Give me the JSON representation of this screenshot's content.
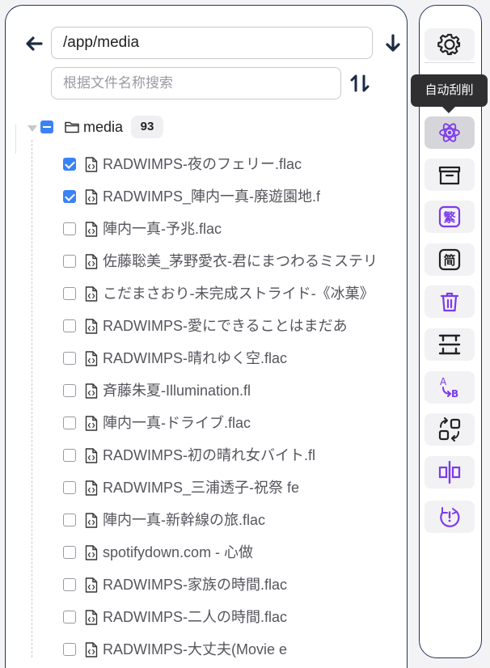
{
  "navigation": {
    "path_value": "/app/media",
    "search_placeholder": "根据文件名称搜索"
  },
  "tree": {
    "root_label": "media",
    "root_count": "93",
    "files": [
      {
        "name": "RADWIMPS-夜のフェリー.flac",
        "checked": true
      },
      {
        "name": "RADWIMPS_陣内一真-廃遊園地.f",
        "checked": true
      },
      {
        "name": "陣内一真-予兆.flac",
        "checked": false
      },
      {
        "name": "佐藤聡美_茅野愛衣-君にまつわるミステリ",
        "checked": false
      },
      {
        "name": "こだまさおり-未完成ストライド-《冰菓》",
        "checked": false
      },
      {
        "name": "RADWIMPS-愛にできることはまだあ",
        "checked": false
      },
      {
        "name": "RADWIMPS-晴れゆく空.flac",
        "checked": false
      },
      {
        "name": "斉藤朱夏-Illumination.fl",
        "checked": false
      },
      {
        "name": "陣内一真-ドライブ.flac",
        "checked": false
      },
      {
        "name": "RADWIMPS-初の晴れ女バイト.fl",
        "checked": false
      },
      {
        "name": "RADWIMPS_三浦透子-祝祭 fe",
        "checked": false
      },
      {
        "name": "陣内一真-新幹線の旅.flac",
        "checked": false
      },
      {
        "name": "spotifydown.com - 心做",
        "checked": false
      },
      {
        "name": "RADWIMPS-家族の時間.flac",
        "checked": false
      },
      {
        "name": "RADWIMPS-二人の時間.flac",
        "checked": false
      },
      {
        "name": "RADWIMPS-大丈夫(Movie e",
        "checked": false
      }
    ]
  },
  "sidebar": {
    "tooltip": "自动刮削",
    "buttons": [
      {
        "name": "settings-button",
        "icon": "gear-icon",
        "active": false
      },
      {
        "name": "auto-scrape-button",
        "icon": "atom-icon",
        "active": true
      },
      {
        "name": "archive-button",
        "icon": "archive-box-icon",
        "active": false
      },
      {
        "name": "traditional-chinese-button",
        "icon": "traditional-char-icon",
        "glyph": "繁",
        "active": false
      },
      {
        "name": "simplified-chinese-button",
        "icon": "simplified-char-icon",
        "glyph": "简",
        "active": false
      },
      {
        "name": "delete-button",
        "icon": "trash-icon",
        "active": false
      },
      {
        "name": "fit-height-button",
        "icon": "vertical-spacing-icon",
        "active": false
      },
      {
        "name": "replace-text-button",
        "icon": "a-to-b-icon",
        "active": false
      },
      {
        "name": "swap-button",
        "icon": "swap-squares-icon",
        "active": false
      },
      {
        "name": "split-button",
        "icon": "split-center-icon",
        "active": false
      },
      {
        "name": "refresh-warning-button",
        "icon": "refresh-alert-icon",
        "active": false
      }
    ]
  },
  "colors": {
    "accent": "#3b82f6",
    "icon_purple": "#7c3aed",
    "panel_border": "#24365f"
  }
}
